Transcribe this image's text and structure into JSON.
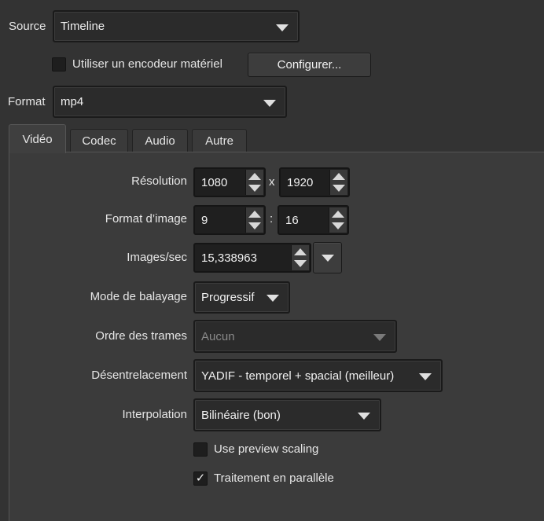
{
  "source": {
    "label": "Source",
    "value": "Timeline"
  },
  "hw_encoder": {
    "label": "Utiliser un encodeur matériel",
    "checked": false,
    "configure_button": "Configurer..."
  },
  "format": {
    "label": "Format",
    "value": "mp4"
  },
  "tabs": [
    {
      "label": "Vidéo",
      "active": true
    },
    {
      "label": "Codec",
      "active": false
    },
    {
      "label": "Audio",
      "active": false
    },
    {
      "label": "Autre",
      "active": false
    }
  ],
  "video": {
    "resolution": {
      "label": "Résolution",
      "width": "1080",
      "separator": "x",
      "height": "1920"
    },
    "aspect": {
      "label": "Format d’image",
      "num": "9",
      "separator": ":",
      "den": "16"
    },
    "fps": {
      "label": "Images/sec",
      "value": "15,338963"
    },
    "scan_mode": {
      "label": "Mode de balayage",
      "value": "Progressif"
    },
    "field_order": {
      "label": "Ordre des trames",
      "value": "Aucun",
      "disabled": true
    },
    "deinterlace": {
      "label": "Désentrelacement",
      "value": "YADIF - temporel + spacial (meilleur)"
    },
    "interpolation": {
      "label": "Interpolation",
      "value": "Bilinéaire (bon)"
    },
    "preview_scaling": {
      "label": "Use preview scaling",
      "checked": false
    },
    "parallel": {
      "label": "Traitement en parallèle",
      "checked": true,
      "check_glyph": "✓"
    }
  },
  "colors": {
    "background": "#333333",
    "panel": "#3b3b3b",
    "field": "#1f1f1f"
  }
}
